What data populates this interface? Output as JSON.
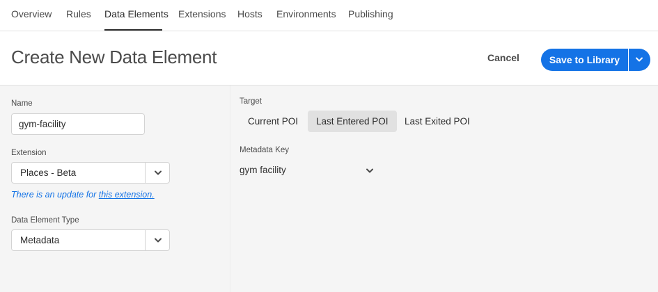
{
  "nav": {
    "tabs": [
      "Overview",
      "Rules",
      "Data Elements",
      "Extensions",
      "Hosts",
      "Environments",
      "Publishing"
    ],
    "active_tab": "Data Elements"
  },
  "header": {
    "title": "Create New Data Element",
    "cancel_label": "Cancel",
    "save_label": "Save to Library"
  },
  "form": {
    "name_label": "Name",
    "name_value": "gym-facility",
    "extension_label": "Extension",
    "extension_value": "Places - Beta",
    "update_note_prefix": "There is an update for ",
    "update_note_link": "this extension.",
    "type_label": "Data Element Type",
    "type_value": "Metadata"
  },
  "config": {
    "target_label": "Target",
    "target_options": [
      "Current POI",
      "Last Entered POI",
      "Last Exited POI"
    ],
    "target_selected": "Last Entered POI",
    "metadata_key_label": "Metadata Key",
    "metadata_key_value": "gym facility"
  },
  "colors": {
    "accent": "#1473e6",
    "panel_bg": "#f5f5f5",
    "selected_segment": "#e1e1e1"
  },
  "icons": {
    "dropdown": "chevron-down-icon"
  }
}
